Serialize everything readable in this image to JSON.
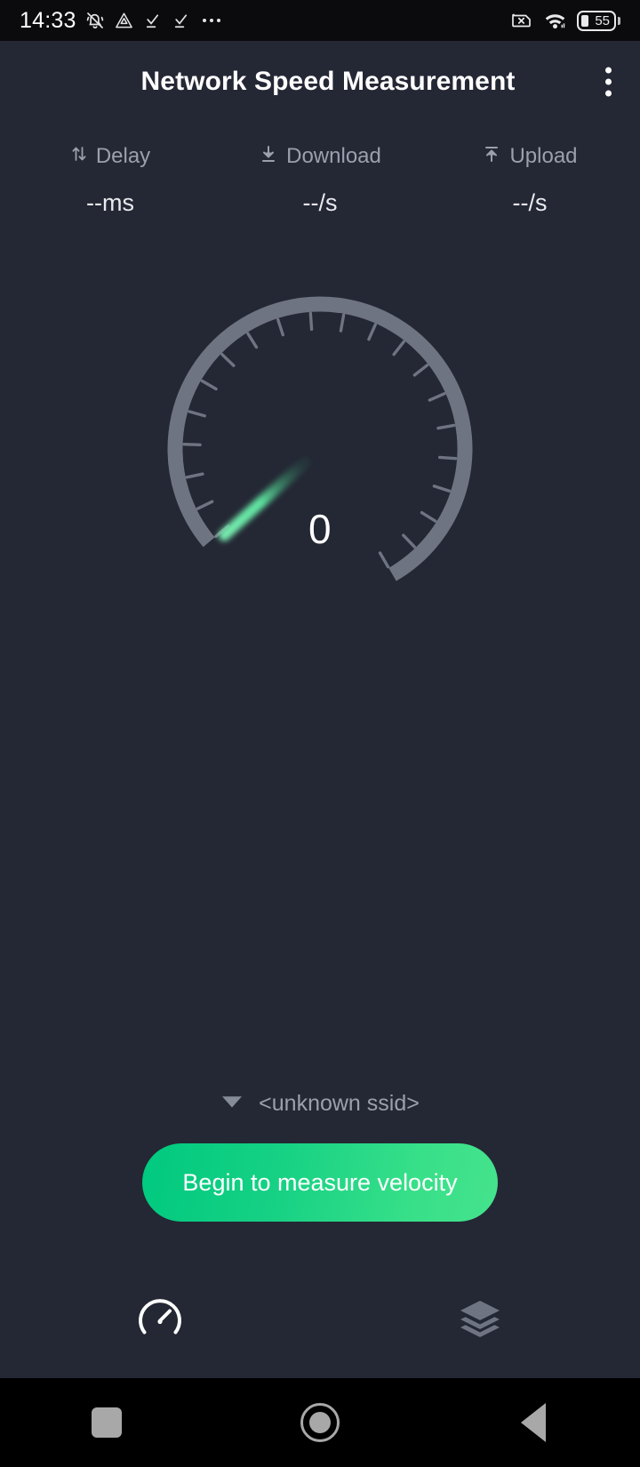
{
  "status_bar": {
    "clock": "14:33",
    "battery_level": "55",
    "icons": [
      "mute-bell-icon",
      "triangle-warning-icon",
      "check-underline-icon",
      "check-underline-icon",
      "more-dots-icon",
      "sim-x-icon",
      "wifi-icon",
      "battery-icon"
    ]
  },
  "app_bar": {
    "title": "Network Speed Measurement",
    "overflow_label": "more-options"
  },
  "stats": [
    {
      "icon": "delay-arrows-icon",
      "label": "Delay",
      "value": "--ms"
    },
    {
      "icon": "download-arrow-icon",
      "label": "Download",
      "value": "--/s"
    },
    {
      "icon": "upload-arrow-icon",
      "label": "Upload",
      "value": "--/s"
    }
  ],
  "gauge": {
    "value": "0",
    "arc_color": "#6f7482",
    "needle_color": "#57e39b",
    "tick_count": 21,
    "start_angle_deg": 220,
    "sweep_deg": 280,
    "needle_angle_deg": 222
  },
  "network": {
    "ssid_icon": "wifi-signal-icon",
    "ssid": "<unknown ssid>"
  },
  "cta": {
    "label": "Begin to measure velocity",
    "gradient_from": "#00c97f",
    "gradient_to": "#45e38c"
  },
  "tabs": [
    {
      "name": "speedometer",
      "icon": "speedometer-icon",
      "active": true
    },
    {
      "name": "layers",
      "icon": "layers-icon",
      "active": false
    }
  ],
  "nav_bar": {
    "recents_label": "recents",
    "home_label": "home",
    "back_label": "back"
  },
  "colors": {
    "background": "#242734",
    "status_bar_bg": "#0b0b0e",
    "muted_text": "#9ba0ad",
    "accent": "#16d184"
  }
}
